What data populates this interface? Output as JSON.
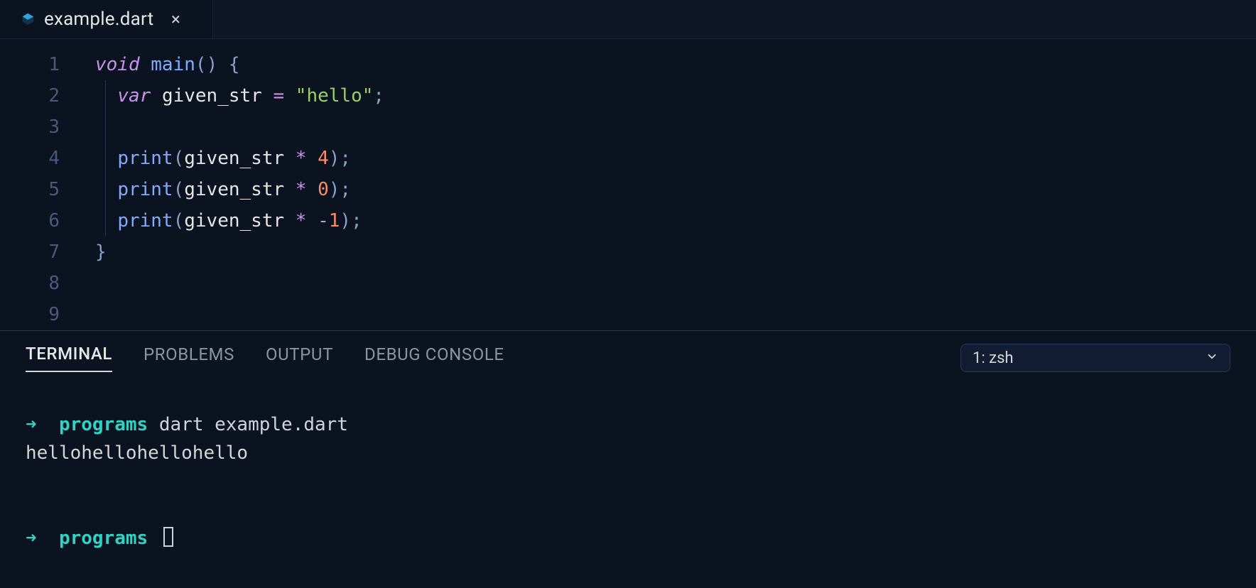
{
  "tab": {
    "filename": "example.dart",
    "close_glyph": "×",
    "icon_color": "#2aa6da"
  },
  "editor": {
    "line_numbers": [
      "1",
      "2",
      "3",
      "4",
      "5",
      "6",
      "7",
      "8",
      "9"
    ],
    "tokens": {
      "kw_void": "void",
      "fn_main": "main",
      "paren_open": "(",
      "paren_close": ")",
      "brace_open": "{",
      "brace_close": "}",
      "kw_var": "var",
      "ident_given_str": "given_str",
      "op_assign": "=",
      "str_hello": "\"hello\"",
      "semicolon": ";",
      "fn_print": "print",
      "op_star": "*",
      "num_4": "4",
      "num_0": "0",
      "minus": "-",
      "num_1": "1"
    }
  },
  "panel": {
    "tabs": {
      "terminal": "TERMINAL",
      "problems": "PROBLEMS",
      "output": "OUTPUT",
      "debug": "DEBUG CONSOLE"
    },
    "shell_selected": "1: zsh"
  },
  "terminal": {
    "prompt_arrow": "➜",
    "prompt_dir": "programs",
    "cmd1": "dart example.dart",
    "out1": "hellohellohellohello"
  }
}
